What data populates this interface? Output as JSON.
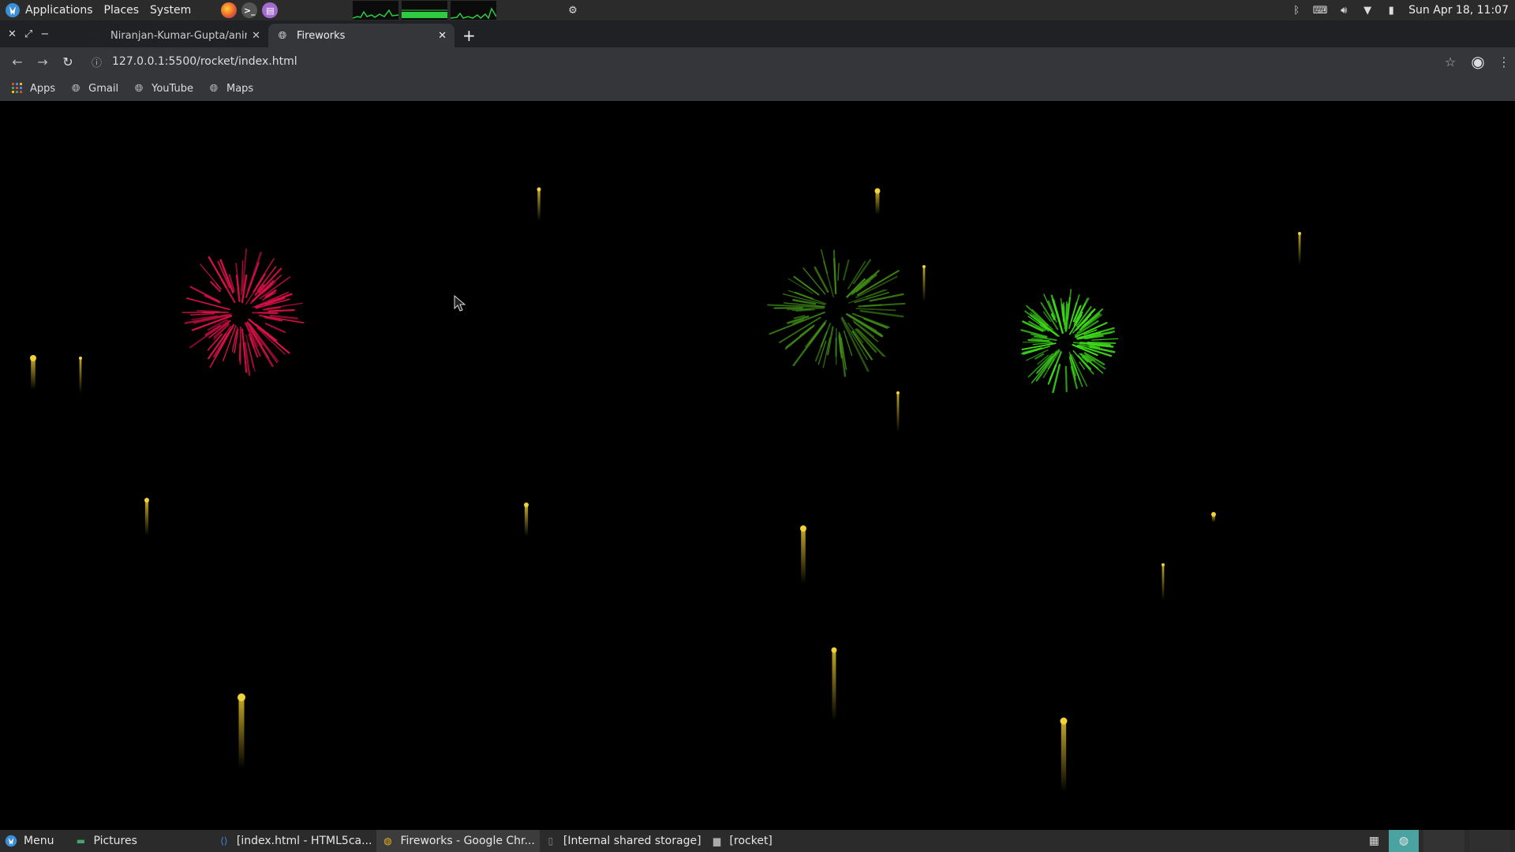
{
  "top_panel": {
    "menus": [
      "Applications",
      "Places",
      "System"
    ],
    "clock": "Sun Apr 18, 11:07"
  },
  "tabs": [
    {
      "title": "Niranjan-Kumar-Gupta/anima",
      "active": false
    },
    {
      "title": "Fireworks",
      "active": true
    }
  ],
  "toolbar": {
    "url": "127.0.0.1:5500/rocket/index.html"
  },
  "bookmarks": [
    {
      "label": "Apps",
      "icon": "apps-grid-icon"
    },
    {
      "label": "Gmail",
      "icon": "globe-icon"
    },
    {
      "label": "YouTube",
      "icon": "globe-icon"
    },
    {
      "label": "Maps",
      "icon": "globe-icon"
    }
  ],
  "taskbar": {
    "menu_label": "Menu",
    "items": [
      {
        "label": "Pictures",
        "icon": "picture-folder-icon"
      },
      {
        "label": "[index.html - HTML5ca...",
        "icon": "vscode-icon"
      },
      {
        "label": "Fireworks - Google Chr...",
        "icon": "chrome-icon",
        "active": true
      },
      {
        "label": "[Internal shared storage]",
        "icon": "phone-icon"
      },
      {
        "label": "[rocket]",
        "icon": "folder-icon"
      }
    ]
  },
  "colors": {
    "burst_red": "#e0124a",
    "burst_dark_green": "#3f8a16",
    "burst_green": "#3fdc1a",
    "rocket_gold": "#d8b92a"
  }
}
